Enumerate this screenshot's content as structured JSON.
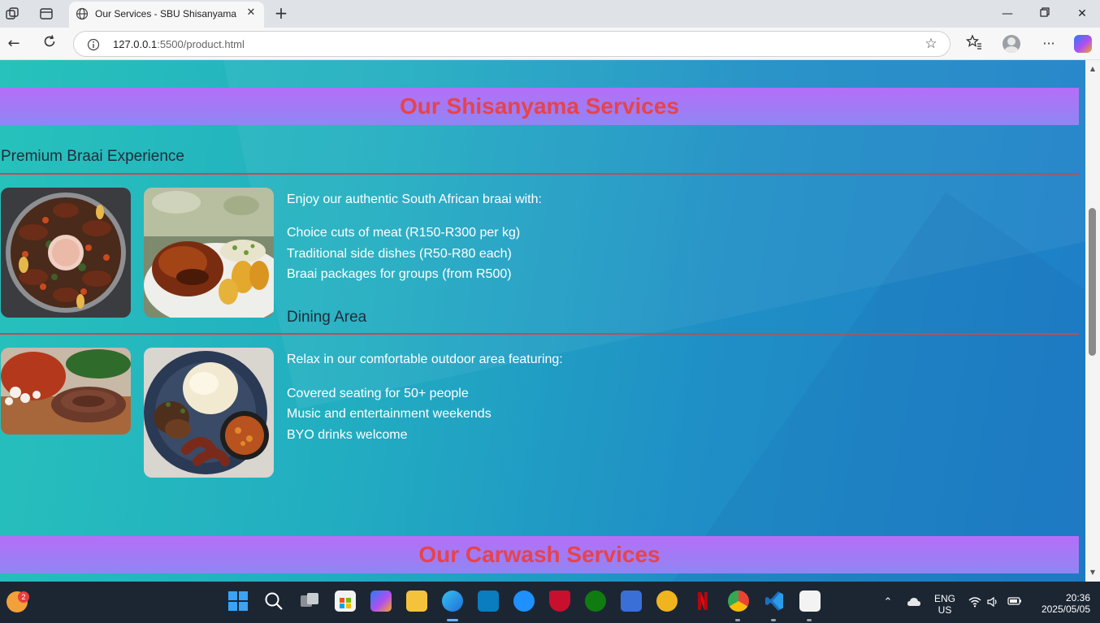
{
  "browser": {
    "tab_title": "Our Services - SBU Shisanyama &",
    "url_host": "127.0.0.1",
    "url_rest": ":5500/product.html"
  },
  "page": {
    "banner_services": "Our Shisanyama Services",
    "banner_carwash": "Our Carwash Services",
    "braai": {
      "title": "Premium Braai Experience",
      "intro": "Enjoy our authentic South African braai with:",
      "items": [
        "Choice cuts of meat (R150-R300 per kg)",
        "Traditional side dishes (R50-R80 each)",
        "Braai packages for groups (from R500)"
      ]
    },
    "dining": {
      "title": "Dining Area",
      "intro": "Relax in our comfortable outdoor area featuring:",
      "items": [
        "Covered seating for 50+ people",
        "Music and entertainment weekends",
        "BYO drinks welcome"
      ]
    }
  },
  "taskbar": {
    "notification_count": "2",
    "lang_line1": "ENG",
    "lang_line2": "US",
    "time": "20:36",
    "date": "2025/05/05"
  },
  "colors": {
    "banner_text": "#e8434a",
    "rule": "#d0454b",
    "section_title": "#1f2d3a"
  }
}
